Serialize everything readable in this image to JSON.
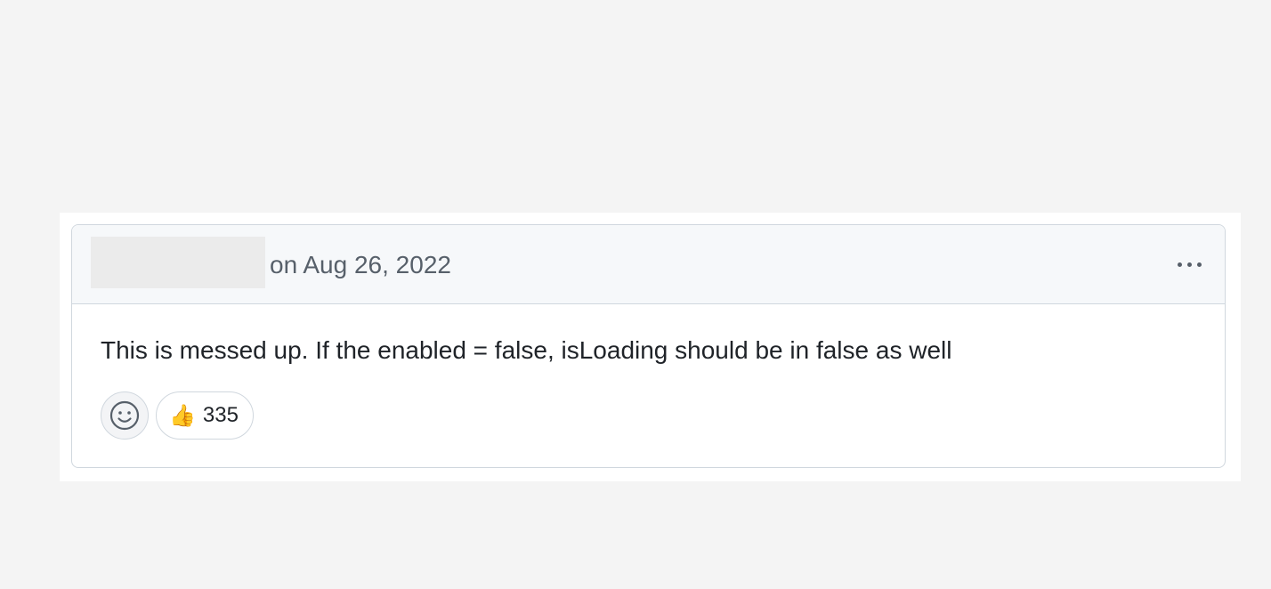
{
  "comment": {
    "timestamp": "on Aug 26, 2022",
    "body": "This is messed up. If the enabled = false, isLoading should be in false as well",
    "reactions": [
      {
        "emoji": "👍",
        "icon": "thumbs-up-icon",
        "count": "335"
      }
    ]
  },
  "icons": {
    "menu": "kebab-horizontal-icon",
    "add_reaction": "smiley-icon"
  },
  "colors": {
    "header_bg": "#f6f8fa",
    "border": "#d0d7de",
    "muted_text": "#57606a",
    "text": "#1f2328"
  }
}
